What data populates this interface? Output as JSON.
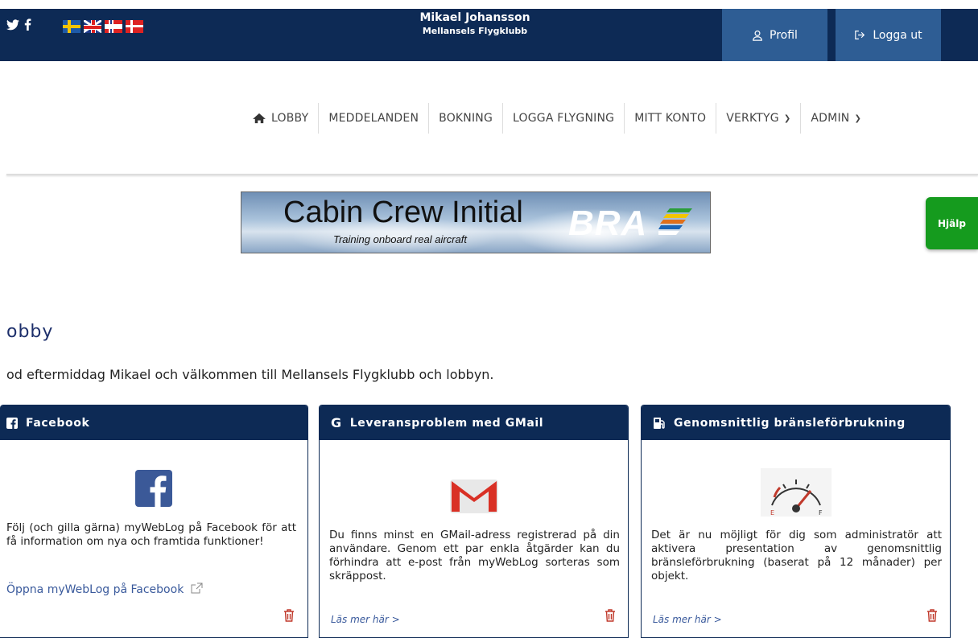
{
  "header": {
    "user_name": "Mikael Johansson",
    "club_name": "Mellansels Flygklubb",
    "profile_label": "Profil",
    "logout_label": "Logga ut"
  },
  "nav": {
    "items": [
      {
        "label": "LOBBY"
      },
      {
        "label": "MEDDELANDEN"
      },
      {
        "label": "BOKNING"
      },
      {
        "label": "LOGGA FLYGNING"
      },
      {
        "label": "MITT KONTO"
      },
      {
        "label": "VERKTYG"
      },
      {
        "label": "ADMIN"
      }
    ]
  },
  "banner": {
    "title": "Cabin Crew Initial",
    "subtitle": "Training onboard real aircraft",
    "brand": "BRA"
  },
  "help_label": "Hjälp",
  "page": {
    "title": "obby",
    "greeting": "od eftermiddag Mikael och välkommen till Mellansels Flygklubb och lobbyn."
  },
  "cards": [
    {
      "title": "Facebook",
      "text": "Följ (och gilla gärna) myWebLog på Facebook för att få information om nya och framtida funktioner!",
      "link": "Öppna myWebLog på Facebook"
    },
    {
      "title": "Leveransproblem med GMail",
      "text": "Du finns minst en GMail-adress registrerad på din användare. Genom ett par enkla åtgärder kan du förhindra att e-post från myWebLog sorteras som skräppost.",
      "more": "Läs mer här >"
    },
    {
      "title": "Genomsnittlig bränsleförbrukning",
      "text": "Det är nu möjligt för dig som administratör att aktivera presentation av genomsnittlig bränsleförbrukning (baserat på 12 månader) per objekt.",
      "more": "Läs mer här >",
      "gauge_empty": "E",
      "gauge_full": "F"
    }
  ]
}
